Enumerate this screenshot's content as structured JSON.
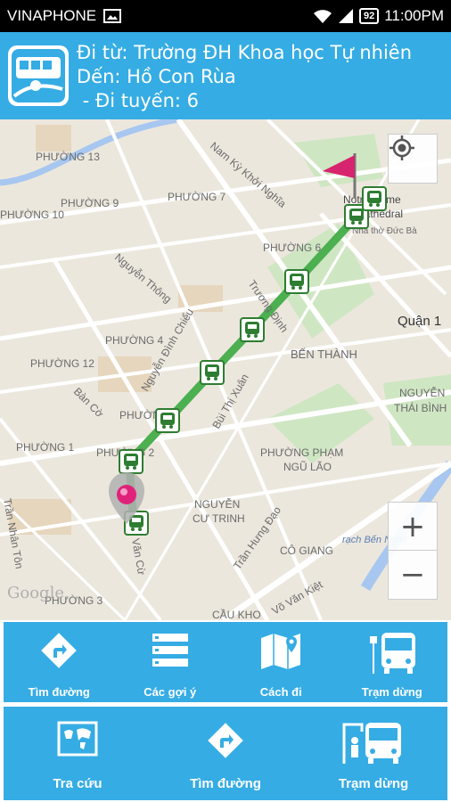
{
  "status": {
    "carrier": "VINAPHONE",
    "battery": "92",
    "time": "11:00PM"
  },
  "header": {
    "from": "Đi từ: Trường ĐH Khoa học Tự nhiên",
    "to": "Dến: Hồ Con Rùa",
    "route": " - Đi tuyến: 6",
    "bg_color": "#35ace4"
  },
  "map": {
    "labels": [
      "PHƯỜNG 13",
      "PHƯỜNG 10",
      "PHƯỜNG 9",
      "PHƯỜNG 7",
      "PHƯỜNG 6",
      "PHƯỜNG 4",
      "PHƯỜNG 12",
      "PHƯỜNG 1",
      "PHƯỜNG 3",
      "PHƯỜNG 2",
      "PHƯỜNG 3",
      "Nam Kỳ Khởi Nghĩa",
      "Nguyễn Thông",
      "Trương Định",
      "Nguyễn Đình Chiểu",
      "Bùi Thị Xuân",
      "Bàn Cờ",
      "Trần Hưng Đạo",
      "Võ Văn Kiệt",
      "Trần Nhân Tôn",
      "Văn Cừ",
      "BẾN THÀNH",
      "Quận 1",
      "NGUYỄN THÁI BÌNH",
      "PHƯỜNG PHẠM NGŨ LÃO",
      "NGUYỄN CƯ TRINH",
      "CÔ GIANG",
      "CẦU KHO",
      "rạch Bến Nghé",
      "Notre Dame Cathedral",
      "Nhà thờ Đức Bà",
      "Google"
    ],
    "route_color": "#4caf50",
    "zoom_in": "+",
    "zoom_out": "−"
  },
  "toolbar1": [
    {
      "label": "Tìm đường",
      "icon": "directions-icon"
    },
    {
      "label": "Các gợi ý",
      "icon": "list-icon"
    },
    {
      "label": "Cách đi",
      "icon": "map-icon"
    },
    {
      "label": "Trạm dừng",
      "icon": "bus-stop-icon"
    }
  ],
  "toolbar2": [
    {
      "label": "Tra cứu",
      "icon": "world-map-icon"
    },
    {
      "label": "Tìm đường",
      "icon": "directions-icon"
    },
    {
      "label": "Trạm dừng",
      "icon": "bus-stop-icon"
    }
  ]
}
